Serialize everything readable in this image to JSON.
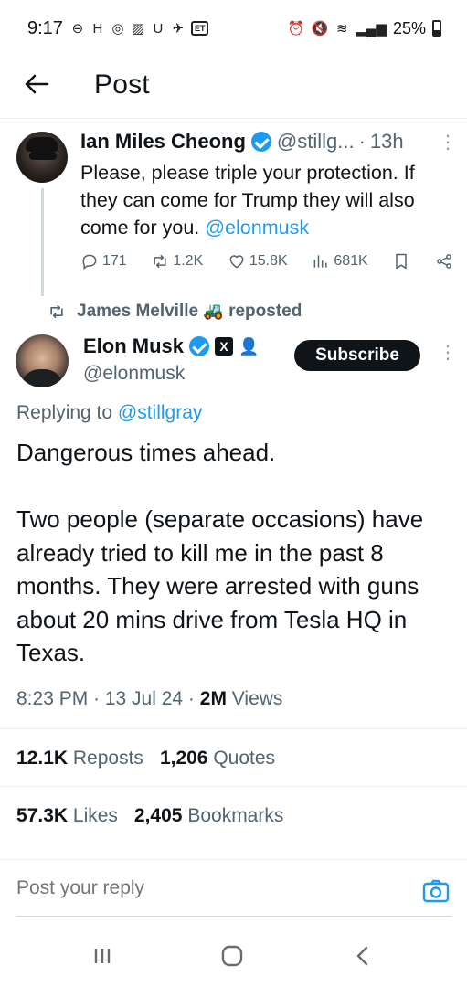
{
  "status_bar": {
    "time": "9:17",
    "left_icons": [
      "sync-icon",
      "hospital-icon",
      "lens-icon",
      "gallery-icon",
      "u-icon",
      "flag-icon",
      "et-icon"
    ],
    "et_label": "ET",
    "battery": "25%"
  },
  "header": {
    "title": "Post"
  },
  "parent_tweet": {
    "name": "Ian Miles Cheong",
    "handle": "@stillg...",
    "time_sep": "·",
    "time": "13h",
    "text_before": "Please, please triple your protection. If they can come for Trump they will also come for you. ",
    "mention": "@elonmusk",
    "actions": {
      "replies": "171",
      "reposts": "1.2K",
      "likes": "15.8K",
      "views": "681K"
    }
  },
  "repost_banner": {
    "text_name": "James Melville",
    "text_suffix": "reposted"
  },
  "main_tweet": {
    "name": "Elon Musk",
    "x_badge": "X",
    "handle": "@elonmusk",
    "subscribe_label": "Subscribe",
    "replying_prefix": "Replying to",
    "replying_handle": "@stillgray",
    "paragraph_1": "Dangerous times ahead.",
    "paragraph_2": "Two people (separate occasions) have already tried to kill me in the past 8 months. They were arrested with guns about 20 mins drive from Tesla HQ in Texas.",
    "timestamp": "8:23 PM · 13 Jul 24 · ",
    "views_count": "2M",
    "views_label": " Views",
    "reposts_count": "12.1K",
    "reposts_label": "Reposts",
    "quotes_count": "1,206",
    "quotes_label": "Quotes",
    "likes_count": "57.3K",
    "likes_label": "Likes",
    "bookmarks_count": "2,405",
    "bookmarks_label": "Bookmarks"
  },
  "reply_bar": {
    "placeholder": "Post your reply"
  },
  "colors": {
    "accent": "#1d9bf0",
    "text": "#0f1419",
    "muted": "#536471",
    "badge_purple": "#c11fd1"
  }
}
